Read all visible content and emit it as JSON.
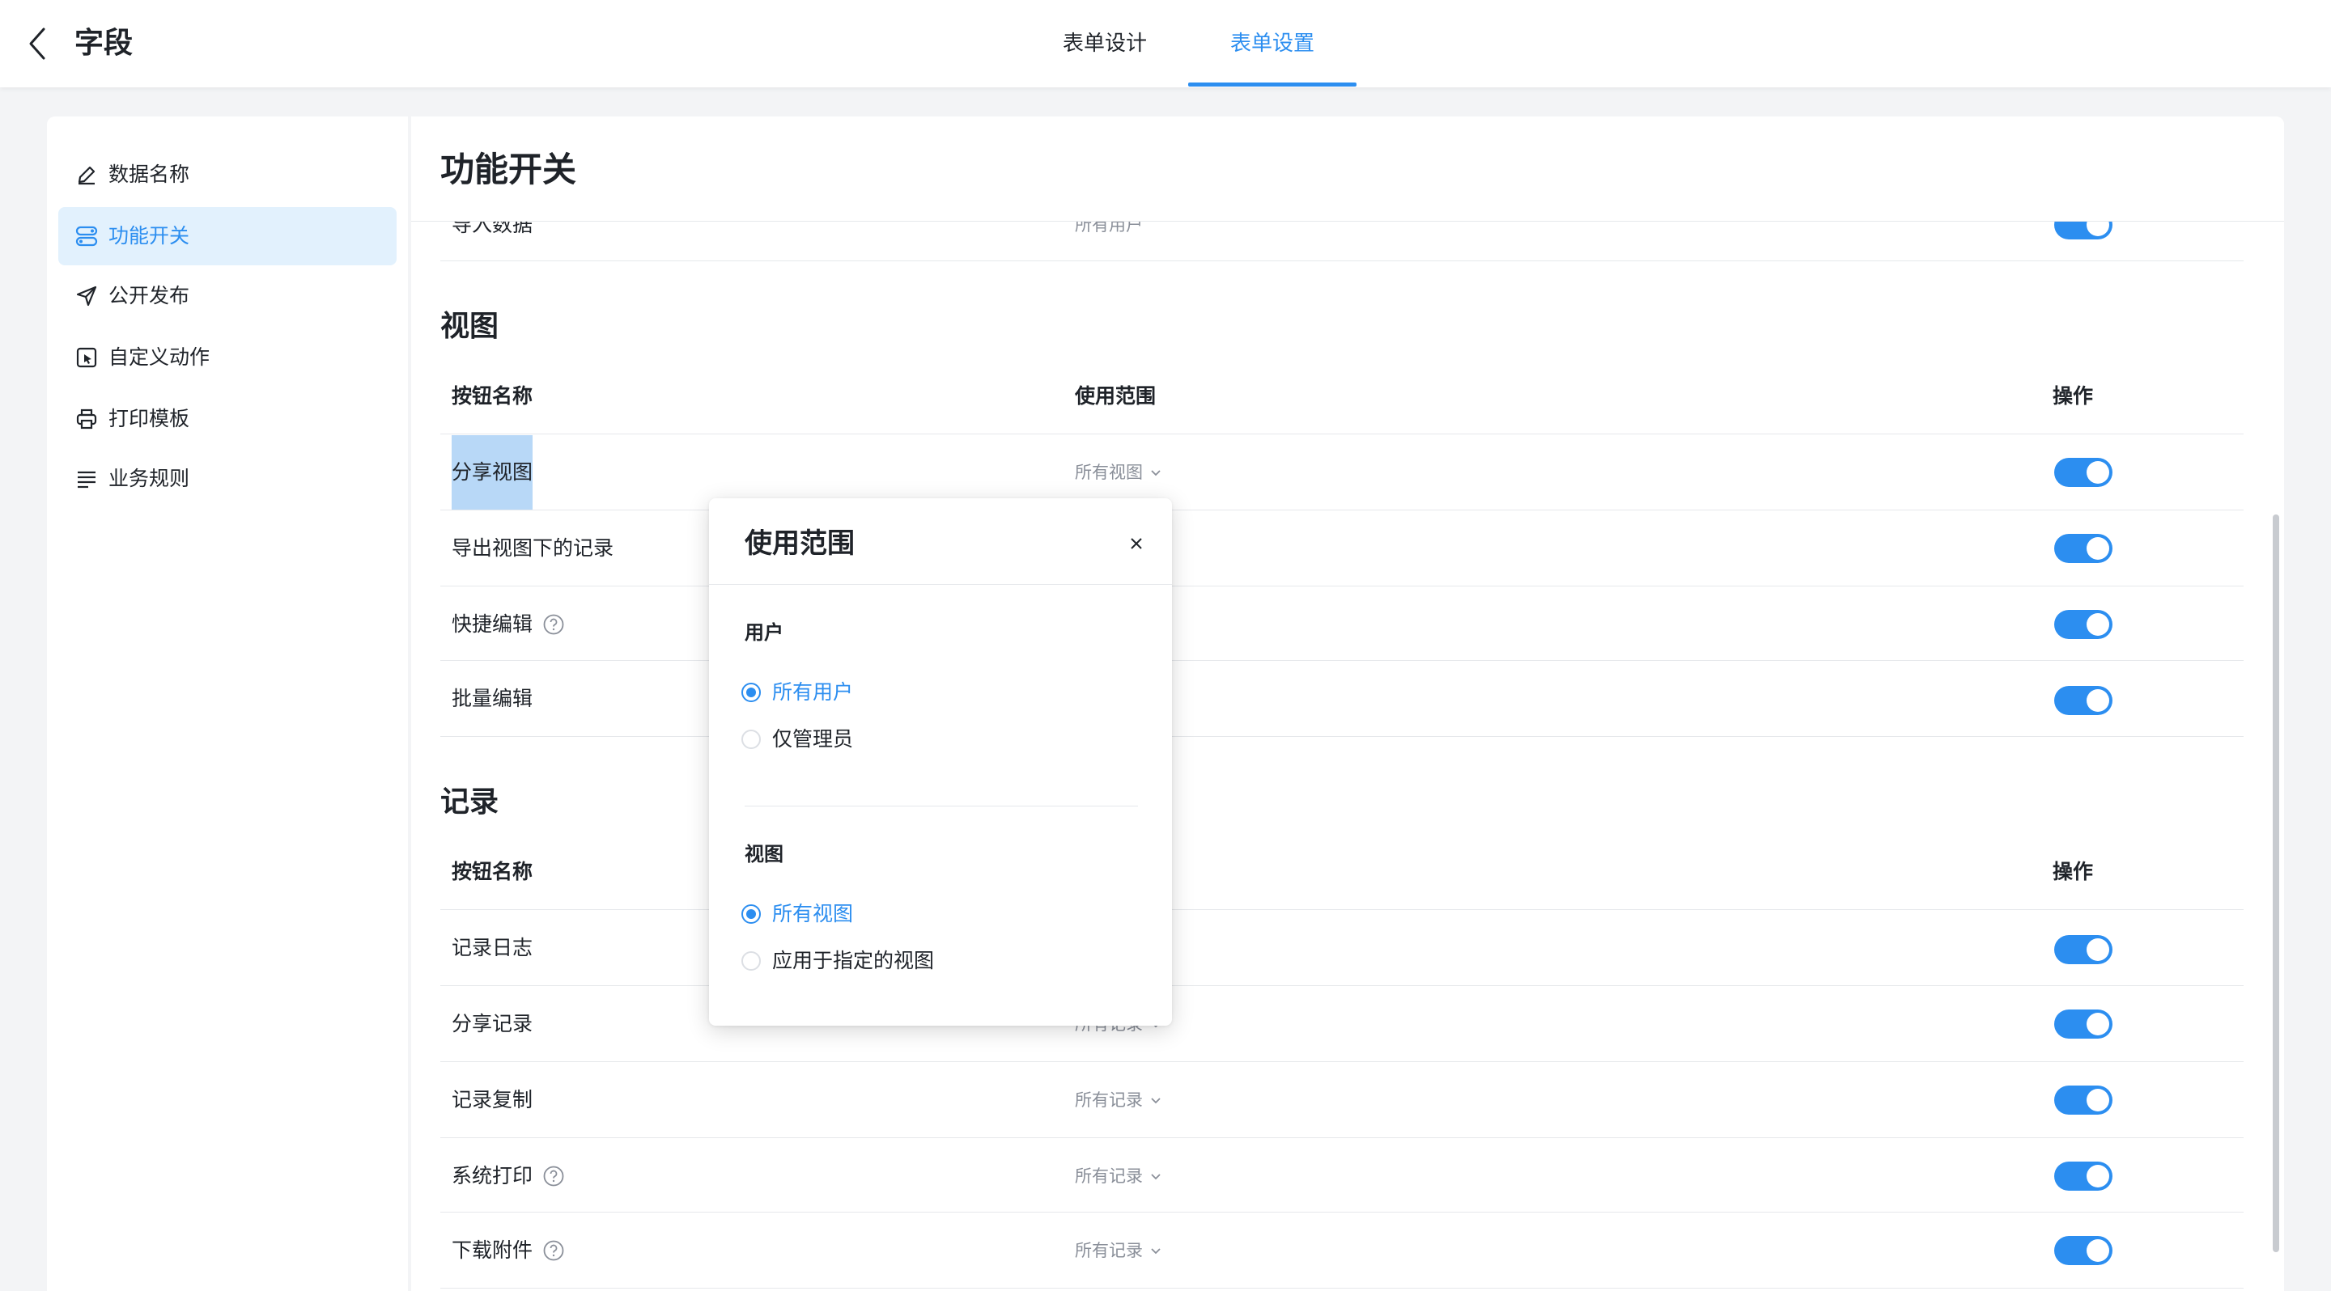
{
  "header": {
    "title": "字段",
    "tabs": [
      {
        "label": "表单设计",
        "active": false
      },
      {
        "label": "表单设置",
        "active": true
      }
    ],
    "accent": "#2c8ef0"
  },
  "sidebar": {
    "items": [
      {
        "label": "数据名称",
        "icon": "edit-icon",
        "active": false
      },
      {
        "label": "功能开关",
        "icon": "switch-icon",
        "active": true
      },
      {
        "label": "公开发布",
        "icon": "send-icon",
        "active": false
      },
      {
        "label": "自定义动作",
        "icon": "custom-action-icon",
        "active": false
      },
      {
        "label": "打印模板",
        "icon": "printer-icon",
        "active": false
      },
      {
        "label": "业务规则",
        "icon": "list-icon",
        "active": false
      }
    ]
  },
  "main": {
    "title": "功能开关",
    "partial_row": {
      "name": "导入数据",
      "scope": "所有用户"
    },
    "view_section": {
      "title": "视图",
      "headers": {
        "name": "按钮名称",
        "scope": "使用范围",
        "action": "操作"
      },
      "rows": [
        {
          "name": "分享视图",
          "scope": "所有视图",
          "enabled": true
        },
        {
          "name": "导出视图下的记录",
          "scope": "",
          "enabled": true
        },
        {
          "name": "快捷编辑",
          "scope": "",
          "enabled": true
        },
        {
          "name": "批量编辑",
          "scope": "",
          "enabled": true
        }
      ]
    },
    "record_section": {
      "title": "记录",
      "headers": {
        "name": "按钮名称",
        "action": "操作"
      },
      "rows": [
        {
          "name": "记录日志",
          "scope": "",
          "enabled": true
        },
        {
          "name": "分享记录",
          "scope": "所有记录",
          "enabled": true
        },
        {
          "name": "记录复制",
          "scope": "所有记录",
          "enabled": true
        },
        {
          "name": "系统打印",
          "scope": "所有记录",
          "enabled": true
        },
        {
          "name": "下载附件",
          "scope": "所有记录",
          "enabled": true
        }
      ]
    }
  },
  "popover": {
    "title": "使用范围",
    "user_section": {
      "label": "用户",
      "options": [
        {
          "label": "所有用户",
          "checked": true
        },
        {
          "label": "仅管理员",
          "checked": false
        }
      ]
    },
    "view_section": {
      "label": "视图",
      "options": [
        {
          "label": "所有视图",
          "checked": true
        },
        {
          "label": "应用于指定的视图",
          "checked": false
        }
      ]
    }
  }
}
